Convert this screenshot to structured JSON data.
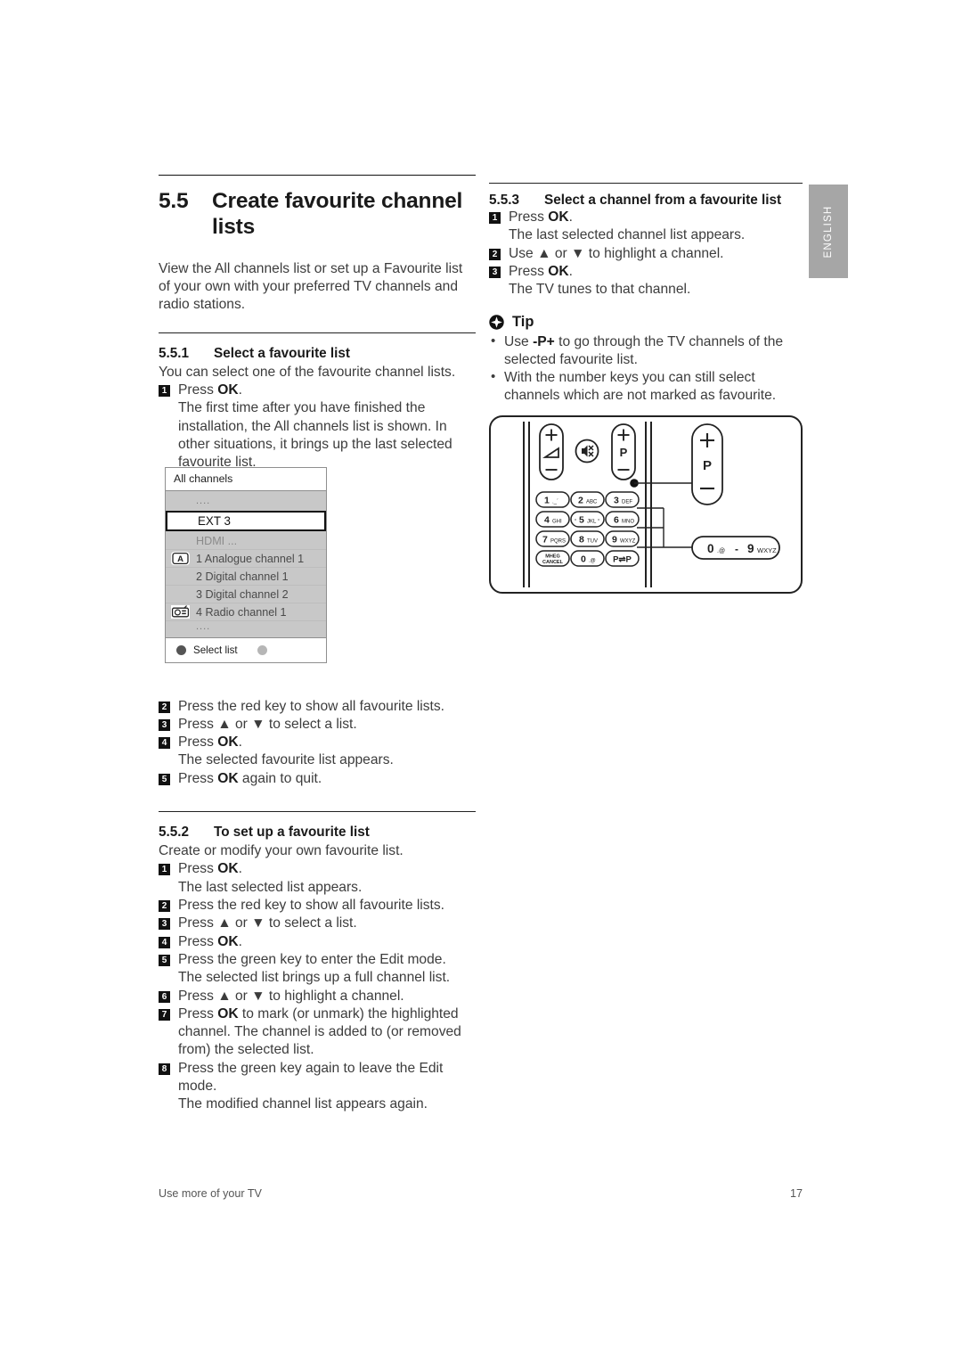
{
  "language_tab": "ENGLISH",
  "section": {
    "number": "5.5",
    "title": "Create favourite channel lists",
    "intro": "View the All channels list or set up a Favourite list of your own with your preferred TV channels and radio stations."
  },
  "sub_551": {
    "number": "5.5.1",
    "title": "Select a favourite list",
    "lead": "You can select one of the favourite channel lists.",
    "steps": [
      {
        "n": "1",
        "pre": "Press ",
        "key": "OK",
        "post": "."
      },
      {
        "n": "2",
        "pre": "Press the red key to show all favourite lists.",
        "key": "",
        "post": ""
      },
      {
        "n": "3",
        "pre": "Press ▲ or ▼ to select a list.",
        "key": "",
        "post": ""
      },
      {
        "n": "4",
        "pre": "Press ",
        "key": "OK",
        "post": "."
      },
      {
        "n": "5",
        "pre": "Press ",
        "key": "OK",
        "post": " again to quit."
      }
    ],
    "note_after_1": "The first time after you have finished the installation, the All channels list is shown. In other situations, it brings up the last selected favourite list.",
    "note_after_4": "The selected favourite list appears."
  },
  "sub_552": {
    "number": "5.5.2",
    "title": "To set up a favourite list",
    "lead": "Create or modify your own favourite list.",
    "note_after_1": "The last selected list appears.",
    "note_after_5": "The selected list brings up a full channel list.",
    "note_after_8": "The modified channel list appears again.",
    "steps": [
      {
        "n": "1",
        "pre": "Press ",
        "key": "OK",
        "post": "."
      },
      {
        "n": "2",
        "pre": "Press the red key to show all favourite lists.",
        "key": "",
        "post": ""
      },
      {
        "n": "3",
        "pre": "Press ▲ or ▼ to select a list.",
        "key": "",
        "post": ""
      },
      {
        "n": "4",
        "pre": "Press ",
        "key": "OK",
        "post": "."
      },
      {
        "n": "5",
        "pre": "Press the green key to enter the Edit mode.",
        "key": "",
        "post": ""
      },
      {
        "n": "6",
        "pre": "Press ▲ or ▼ to highlight a channel.",
        "key": "",
        "post": ""
      },
      {
        "n": "7",
        "pre": "Press ",
        "key": "OK",
        "post": " to mark (or unmark) the highlighted channel. The channel is added to (or removed from) the selected list."
      },
      {
        "n": "8",
        "pre": "Press the green key again to leave the Edit mode.",
        "key": "",
        "post": ""
      }
    ]
  },
  "sub_553": {
    "number": "5.5.3",
    "title": "Select a channel from a favourite list",
    "steps": [
      {
        "n": "1",
        "pre": "Press ",
        "key": "OK",
        "post": "."
      },
      {
        "n": "2",
        "pre": "Use ▲ or ▼ to highlight a channel.",
        "key": "",
        "post": ""
      },
      {
        "n": "3",
        "pre": "Press ",
        "key": "OK",
        "post": "."
      }
    ],
    "note_after_1": "The last selected channel list appears.",
    "note_after_3": "The TV tunes to that channel."
  },
  "tip": {
    "label": "Tip",
    "items": [
      {
        "pre": "Use ",
        "key": "-P+",
        "post": " to go through the TV channels of the selected favourite list."
      },
      {
        "pre": "With the number keys you can still select channels which are not marked as favourite.",
        "key": "",
        "post": ""
      }
    ]
  },
  "channel_list": {
    "header": "All channels",
    "rows": [
      {
        "label": "....",
        "type": "dots",
        "icon": ""
      },
      {
        "label": "EXT 3",
        "type": "selected",
        "icon": ""
      },
      {
        "label": "HDMI ...",
        "type": "dim",
        "icon": ""
      },
      {
        "label": "1 Analogue channel 1",
        "type": "normal",
        "icon": "analogue-icon"
      },
      {
        "label": "2 Digital channel 1",
        "type": "normal",
        "icon": ""
      },
      {
        "label": "3 Digital channel 2",
        "type": "normal",
        "icon": ""
      },
      {
        "label": "4 Radio channel 1",
        "type": "normal",
        "icon": "radio-icon"
      },
      {
        "label": "....",
        "type": "dots",
        "icon": ""
      }
    ],
    "footer_label": "Select list",
    "footer_dot_red": "#555555",
    "footer_dot_green": "#b6b6b6"
  },
  "remote": {
    "volume": {
      "plus": "+",
      "minus": "−",
      "icon": "speaker-wedge-icon"
    },
    "mute": {
      "icon": "mute-icon"
    },
    "program": {
      "plus": "+",
      "label": "P",
      "minus": "−"
    },
    "callout_program": {
      "plus": "+",
      "label": "P",
      "minus": "−"
    },
    "callout_numbers": {
      "from_digit": "0",
      "from_sub": ".@",
      "dash": "-",
      "to_digit": "9",
      "to_sub": "WXYZ"
    },
    "keypad": [
      [
        {
          "digit": "1",
          "sub": "._´"
        },
        {
          "digit": "2",
          "sub": "ABC"
        },
        {
          "digit": "3",
          "sub": "DEF"
        }
      ],
      [
        {
          "digit": "4",
          "sub": "GHI"
        },
        {
          "digit": "5",
          "sub": "JKL",
          "ring": true
        },
        {
          "digit": "6",
          "sub": "MNO"
        }
      ],
      [
        {
          "digit": "7",
          "sub": "PQRS"
        },
        {
          "digit": "8",
          "sub": "TUV"
        },
        {
          "digit": "9",
          "sub": "WXYZ"
        }
      ],
      [
        {
          "digit": "",
          "sub": "",
          "two_line": "MHEG\nCANCEL"
        },
        {
          "digit": "0",
          "sub": ".@"
        },
        {
          "digit": "",
          "sub": "",
          "swap": "P⇌P"
        }
      ]
    ]
  },
  "footer": {
    "left": "Use more of your TV",
    "page": "17"
  }
}
